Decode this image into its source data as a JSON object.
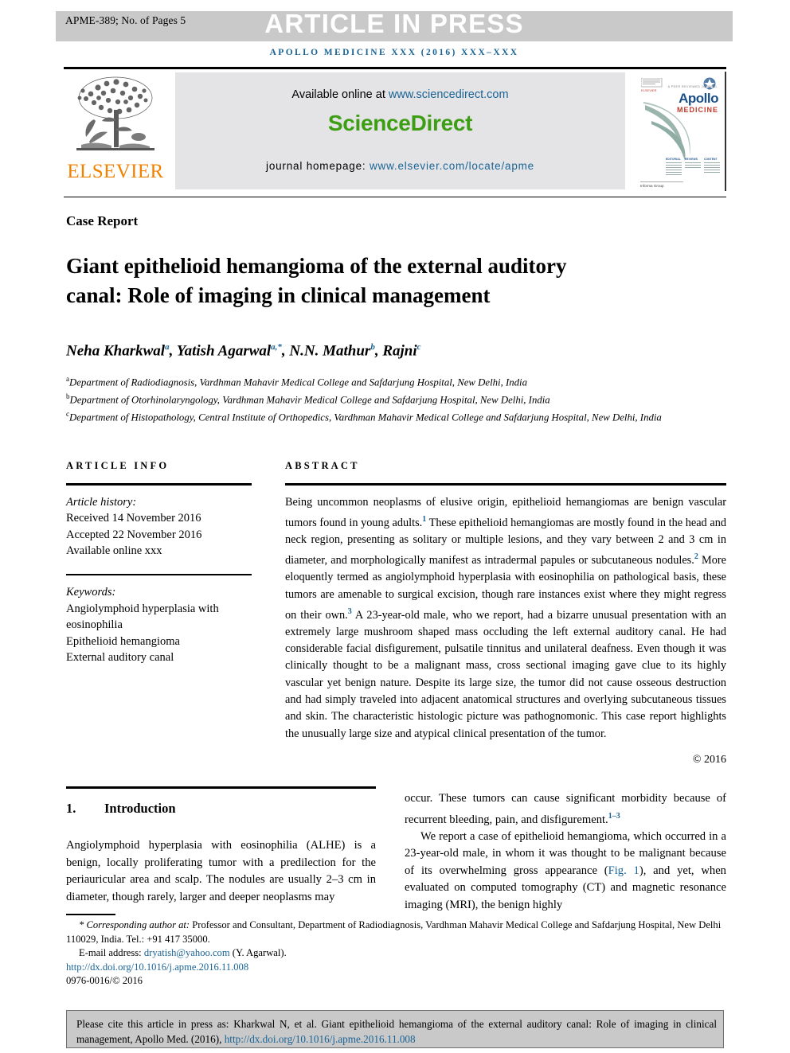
{
  "running_head": {
    "proof_id": "APME-389; No. of Pages 5",
    "banner": "ARTICLE IN PRESS",
    "journal_line": "APOLLO MEDICINE XXX (2016) XXX–XXX"
  },
  "masthead": {
    "available_prefix": "Available online at ",
    "sciencedirect_url": "www.sciencedirect.com",
    "sciencedirect_logo": "ScienceDirect",
    "homepage_prefix": "journal homepage: ",
    "homepage_url": "www.elsevier.com/locate/apme",
    "elsevier_wordmark": "ELSEVIER",
    "cover": {
      "title": "Apollo",
      "subtitle": "MEDICINE",
      "tagline": "A PEER REVIEWED JOURNAL",
      "col_headings": [
        "EDITORIAL",
        "REVIEWS",
        "CONTENT"
      ],
      "footer": "Informa Group"
    }
  },
  "article": {
    "type": "Case Report",
    "title": "Giant epithelioid hemangioma of the external auditory canal: Role of imaging in clinical management",
    "authors_html": "Neha Kharkwal<sup>a</sup>, Yatish Agarwal<sup>a,*</sup>, N.N. Mathur<sup>b</sup>, Rajni<sup>c</sup>",
    "affiliations": [
      {
        "mark": "a",
        "text": "Department of Radiodiagnosis, Vardhman Mahavir Medical College and Safdarjung Hospital, New Delhi, India"
      },
      {
        "mark": "b",
        "text": "Department of Otorhinolaryngology, Vardhman Mahavir Medical College and Safdarjung Hospital, New Delhi, India"
      },
      {
        "mark": "c",
        "text": "Department of Histopathology, Central Institute of Orthopedics, Vardhman Mahavir Medical College and Safdarjung Hospital, New Delhi, India"
      }
    ]
  },
  "article_info": {
    "heading": "ARTICLE INFO",
    "history_label": "Article history:",
    "received": "Received 14 November 2016",
    "accepted": "Accepted 22 November 2016",
    "available_online": "Available online xxx",
    "keywords_label": "Keywords:",
    "keywords": [
      "Angiolymphoid hyperplasia with eosinophilia",
      "Epithelioid hemangioma",
      "External auditory canal"
    ]
  },
  "abstract": {
    "heading": "ABSTRACT",
    "body_html": "Being uncommon neoplasms of elusive origin, epithelioid hemangiomas are benign vascular tumors found in young adults.<sup>1</sup> These epithelioid hemangiomas are mostly found in the head and neck region, presenting as solitary or multiple lesions, and they vary between 2 and 3 cm in diameter, and morphologically manifest as intradermal papules or subcutaneous nodules.<sup>2</sup> More eloquently termed as angiolymphoid hyperplasia with eosinophilia on pathological basis, these tumors are amenable to surgical excision, though rare instances exist where they might regress on their own.<sup>3</sup> A 23-year-old male, who we report, had a bizarre unusual presentation with an extremely large mushroom shaped mass occluding the left external auditory canal. He had considerable facial disfigurement, pulsatile tinnitus and unilateral deafness. Even though it was clinically thought to be a malignant mass, cross sectional imaging gave clue to its highly vascular yet benign nature. Despite its large size, the tumor did not cause osseous destruction and had simply traveled into adjacent anatomical structures and overlying subcutaneous tissues and skin. The characteristic histologic picture was pathognomonic. This case report highlights the unusually large size and atypical clinical presentation of the tumor.",
    "copyright": "© 2016"
  },
  "introduction": {
    "number": "1.",
    "heading": "Introduction",
    "left_para_html": "Angiolymphoid hyperplasia with eosinophilia (ALHE) is a benign, locally proliferating tumor with a predilection for the periauricular area and scalp. The nodules are usually 2–3 cm in diameter, though rarely, larger and deeper neoplasms may",
    "right_para1_html": "occur. These tumors can cause significant morbidity because of recurrent bleeding, pain, and disfigurement.<sup>1–3</sup>",
    "right_para2_html": "We report a case of epithelioid hemangioma, which occurred in a 23-year-old male, in whom it was thought to be malignant because of its overwhelming gross appearance (<span class=\"blue\">Fig. 1</span>), and yet, when evaluated on computed tomography (CT) and magnetic resonance imaging (MRI), the benign highly"
  },
  "footnote": {
    "corresponding_html": "<span class=\"it\">* Corresponding author at:</span> Professor and Consultant, Department of Radiodiagnosis, Vardhman Mahavir Medical College and Safdarjung Hospital, New Delhi 110029, India. Tel.: +91 417 35000.",
    "email_html": "E-mail address: <a href=\"#\">dryatish@yahoo.com</a> (Y. Agarwal).",
    "doi": "http://dx.doi.org/10.1016/j.apme.2016.11.008",
    "issn": "0976-0016/© 2016"
  },
  "cite_box": {
    "text_html": "Please cite this article in press as: Kharkwal N, et al. Giant epithelioid hemangioma of the external auditory canal: Role of imaging in clinical management, Apollo Med. (2016), <a href=\"#\">http://dx.doi.org/10.1016/j.apme.2016.11.008</a>"
  },
  "colors": {
    "link_blue": "#1a6496",
    "elsevier_orange": "#ef8200",
    "sciencedirect_green": "#3d9e14",
    "banner_gray": "#c9c9c9",
    "panel_gray": "#e4e4e6"
  }
}
